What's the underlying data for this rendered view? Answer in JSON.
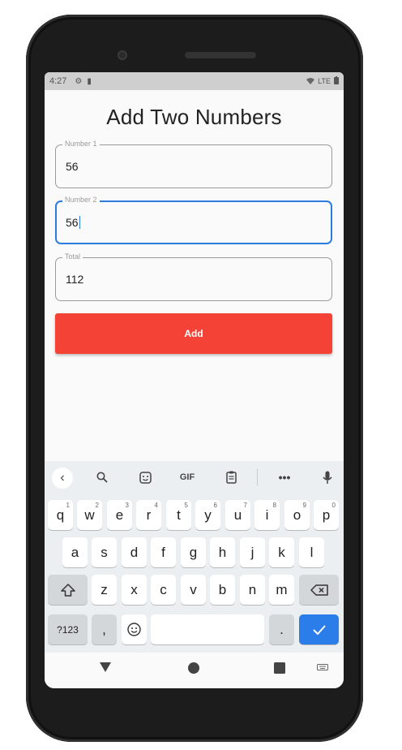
{
  "status_bar": {
    "time": "4:27",
    "icons_left": [
      "gear-icon",
      "sd-card-icon"
    ],
    "network": "LTE",
    "icons_right": [
      "wifi-icon",
      "battery-icon"
    ]
  },
  "app": {
    "title": "Add Two Numbers",
    "fields": [
      {
        "label": "Number 1",
        "value": "56",
        "focused": false
      },
      {
        "label": "Number 2",
        "value": "56",
        "focused": true
      },
      {
        "label": "Total",
        "value": "112",
        "focused": false
      }
    ],
    "add_button": "Add",
    "accent_color": "#f44336",
    "focus_color": "#2e7be0"
  },
  "keyboard": {
    "toolbar": [
      "back-icon",
      "search-icon",
      "sticker-icon",
      "GIF",
      "clipboard-icon",
      "more-icon",
      "mic-icon"
    ],
    "row1": [
      {
        "key": "q",
        "hint": "1"
      },
      {
        "key": "w",
        "hint": "2"
      },
      {
        "key": "e",
        "hint": "3"
      },
      {
        "key": "r",
        "hint": "4"
      },
      {
        "key": "t",
        "hint": "5"
      },
      {
        "key": "y",
        "hint": "6"
      },
      {
        "key": "u",
        "hint": "7"
      },
      {
        "key": "i",
        "hint": "8"
      },
      {
        "key": "o",
        "hint": "9"
      },
      {
        "key": "p",
        "hint": "0"
      }
    ],
    "row2": [
      "a",
      "s",
      "d",
      "f",
      "g",
      "h",
      "j",
      "k",
      "l"
    ],
    "row3": [
      "z",
      "x",
      "c",
      "v",
      "b",
      "n",
      "m"
    ],
    "row4": {
      "symbols": "?123",
      "comma": ",",
      "period": "."
    },
    "enter_color": "#2b7de9"
  },
  "navbar": [
    "back-triangle-icon",
    "home-circle-icon",
    "recents-square-icon",
    "keyboard-switch-icon"
  ]
}
